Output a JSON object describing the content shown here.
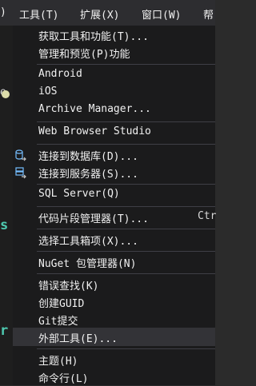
{
  "menubar": {
    "items": [
      {
        "label": ")"
      },
      {
        "label": "工具(T)"
      },
      {
        "label": "扩展(X)"
      },
      {
        "label": "窗口(W)"
      },
      {
        "label": "帮"
      }
    ]
  },
  "left_panel": {
    "fragments": [
      "ge",
      "s",
      "r"
    ]
  },
  "menu": {
    "items": [
      {
        "label": "获取工具和功能(T)..."
      },
      {
        "label": "管理和预览(P)功能"
      },
      {
        "label": "Android"
      },
      {
        "label": "iOS"
      },
      {
        "label": "Archive Manager..."
      },
      {
        "label": "Web Browser Studio"
      },
      {
        "label": "连接到数据库(D)...",
        "icon": "database-connect-icon"
      },
      {
        "label": "连接到服务器(S)...",
        "icon": "server-connect-icon"
      },
      {
        "label": "SQL Server(Q)"
      },
      {
        "label": "代码片段管理器(T)...",
        "shortcut": "Ctr"
      },
      {
        "label": "选择工具箱项(X)..."
      },
      {
        "label": "NuGet 包管理器(N)"
      },
      {
        "label": "错误查找(K)"
      },
      {
        "label": "创建GUID"
      },
      {
        "label": "Git提交"
      },
      {
        "label": "外部工具(E)...",
        "highlighted": true
      },
      {
        "label": "主题(H)"
      },
      {
        "label": "命令行(L)"
      }
    ]
  },
  "colors": {
    "menu_bg": "#1b1b1c",
    "menubar_bg": "#2d2d30",
    "hover_bg": "#333337",
    "separator": "#3f3f46",
    "text": "#f1f1f1",
    "accent_green": "#4ec9b0",
    "accent_yellow": "#dcdcaa"
  }
}
